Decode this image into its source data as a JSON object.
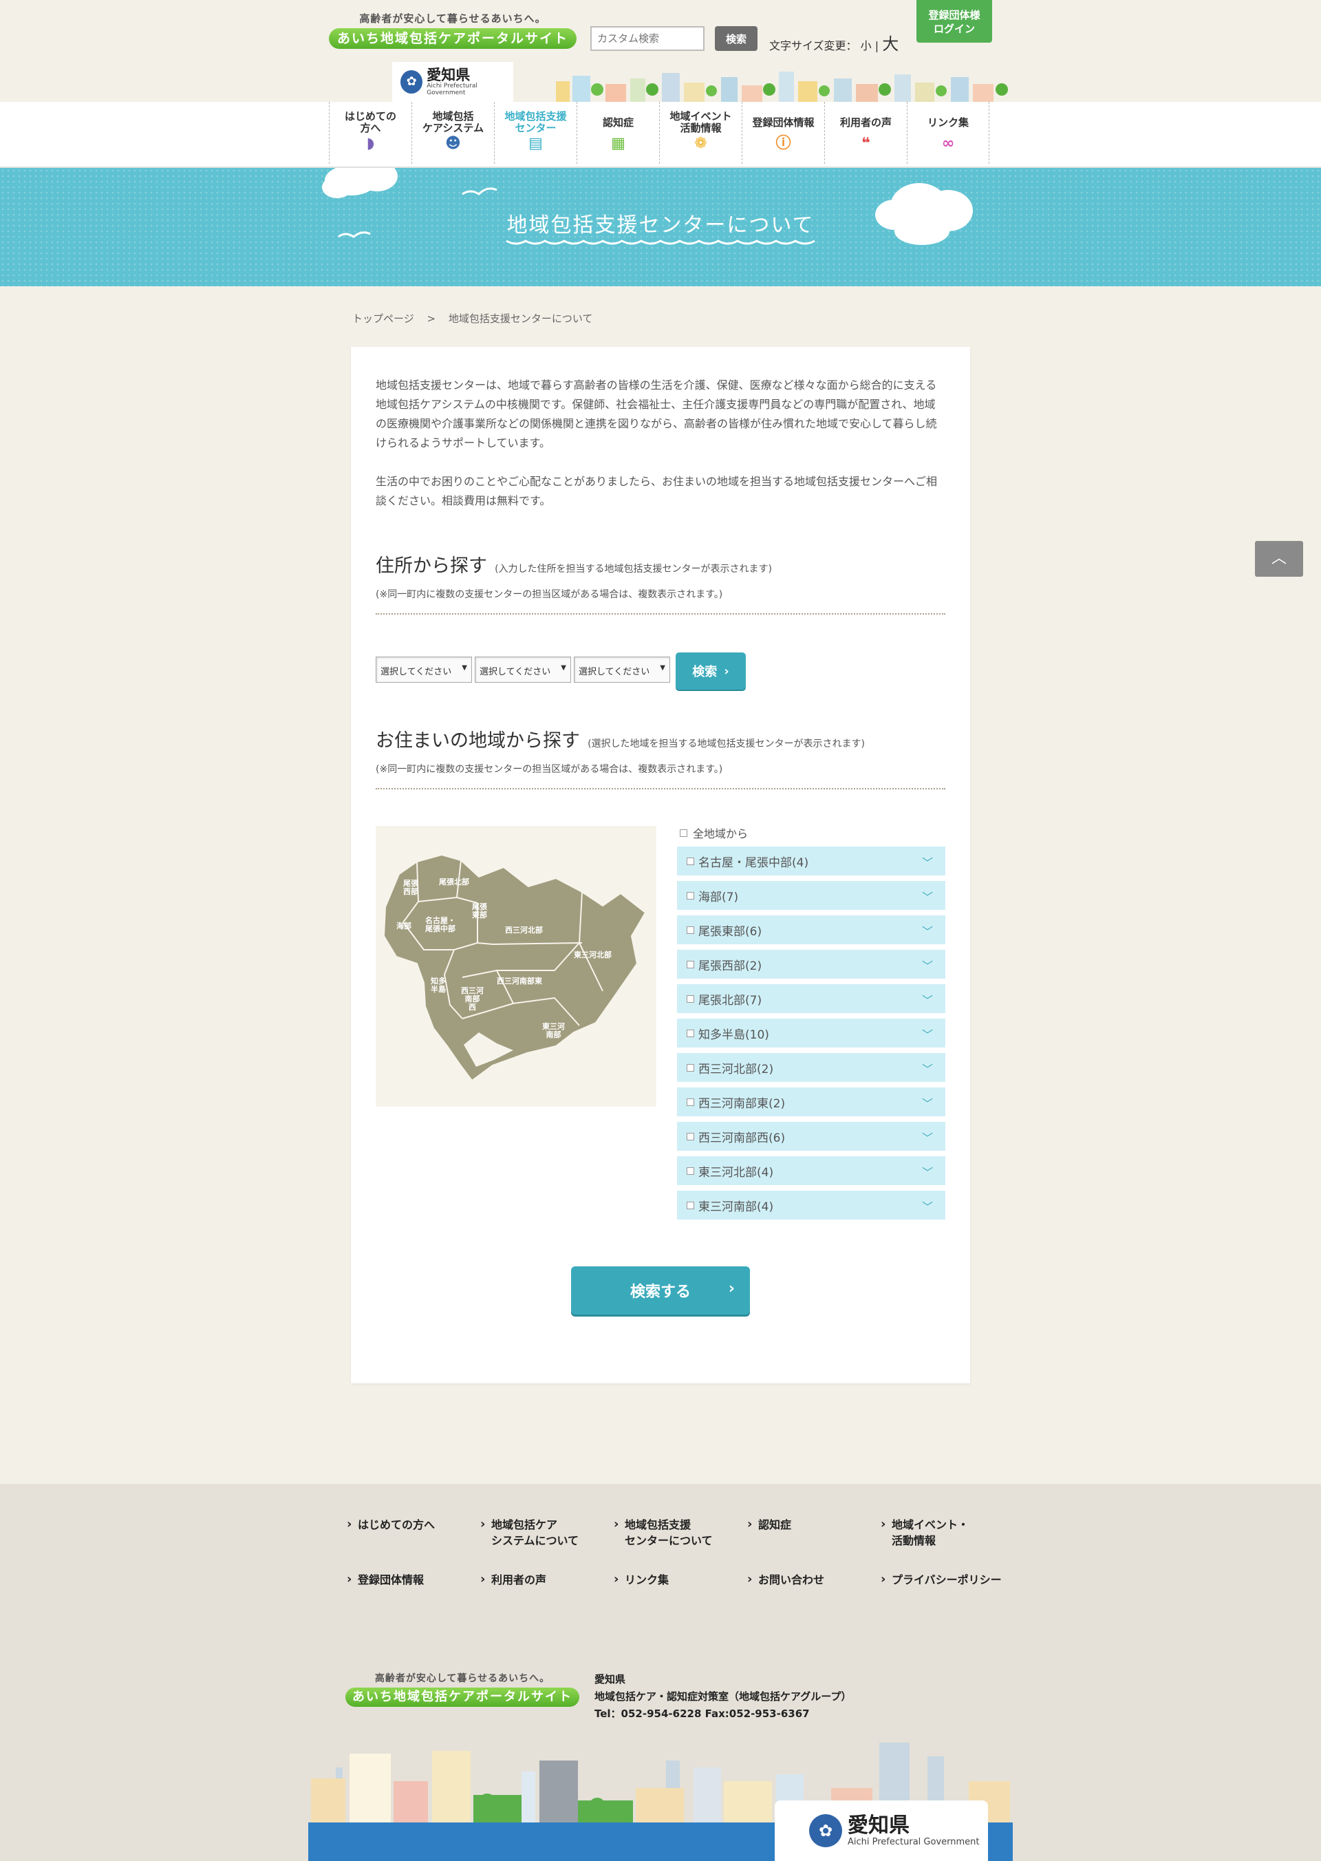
{
  "header": {
    "tagline": "高齢者が安心して暮らせるあいちへ。",
    "site_title": "あいち地域包括ケアポータルサイト",
    "search_placeholder": "カスタム検索",
    "search_button": "検索",
    "fontsize_label": "文字サイズ変更：",
    "fontsize_small": "小",
    "fontsize_sep": "|",
    "fontsize_large": "大",
    "login_line1": "登録団体様",
    "login_line2": "ログイン",
    "pref_name": "愛知県",
    "pref_name_en": "Aichi Prefectural Government"
  },
  "nav": {
    "items": [
      {
        "label": "はじめての\n方へ",
        "icon": "shoshinsha-mark-icon"
      },
      {
        "label": "地域包括\nケアシステム",
        "icon": "person-icon"
      },
      {
        "label": "地域包括支援\nセンター",
        "icon": "building-icon"
      },
      {
        "label": "認知症",
        "icon": "notebook-icon"
      },
      {
        "label": "地域イベント\n活動情報",
        "icon": "balloons-icon"
      },
      {
        "label": "登録団体情報",
        "icon": "info-icon"
      },
      {
        "label": "利用者の声",
        "icon": "speech-bubble-icon"
      },
      {
        "label": "リンク集",
        "icon": "link-icon"
      }
    ]
  },
  "banner": {
    "title": "地域包括支援センターについて"
  },
  "breadcrumb": {
    "home": "トップページ",
    "sep": ">",
    "current": "地域包括支援センターについて"
  },
  "intro": {
    "p1": "地域包括支援センターは、地域で暮らす高齢者の皆様の生活を介護、保健、医療など様々な面から総合的に支える地域包括ケアシステムの中核機関です。保健師、社会福祉士、主任介護支援専門員などの専門職が配置され、地域の医療機関や介護事業所などの関係機関と連携を図りながら、高齢者の皆様が住み慣れた地域で安心して暮らし続けられるようサポートしています。",
    "p2": "生活の中でお困りのことやご心配なことがありましたら、お住まいの地域を担当する地域包括支援センターへご相談ください。相談費用は無料です。"
  },
  "address_search": {
    "title": "住所から探す",
    "subtitle": "(入力した住所を担当する地域包括支援センターが表示されます)",
    "note": "(※同一町内に複数の支援センターの担当区域がある場合は、複数表示されます。)",
    "selects": [
      "選択してください",
      "選択してください",
      "選択してください"
    ],
    "button": "検索"
  },
  "area_search": {
    "title": "お住まいの地域から探す",
    "subtitle": "(選択した地域を担当する地域包括支援センターが表示されます)",
    "note": "(※同一町内に複数の支援センターの担当区域がある場合は、複数表示されます。)",
    "all_label": "全地域から",
    "regions": [
      "名古屋・尾張中部(4)",
      "海部(7)",
      "尾張東部(6)",
      "尾張西部(2)",
      "尾張北部(7)",
      "知多半島(10)",
      "西三河北部(2)",
      "西三河南部東(2)",
      "西三河南部西(6)",
      "東三河北部(4)",
      "東三河南部(4)"
    ],
    "map_labels": {
      "owari_seibu": "尾張\n西部",
      "owari_hokubu": "尾張北部",
      "ama": "海部",
      "nagoya": "名古屋・\n尾張中部",
      "owari_tobu": "尾張\n東部",
      "nishimikawa_hokubu": "西三河北部",
      "higashimikawa_hokubu": "東三河北部",
      "chita": "知多\n半島",
      "nishimikawa_nanbu_nishi": "西三河\n南部\n西",
      "nishimikawa_nanbu_higashi": "西三河南部東",
      "higashimikawa_nanbu": "東三河\n南部"
    },
    "submit": "検索する"
  },
  "to_top_icon": "chevron-up-icon",
  "footer": {
    "links_row1": [
      "はじめての方へ",
      "地域包括ケア\nシステムについて",
      "地域包括支援\nセンターについて",
      "認知症",
      "地域イベント・\n活動情報"
    ],
    "links_row2": [
      "登録団体情報",
      "利用者の声",
      "リンク集",
      "お問い合わせ",
      "プライバシーポリシー"
    ],
    "tagline": "高齢者が安心して暮らせるあいちへ。",
    "site_title": "あいち地域包括ケアポータルサイト",
    "org": "愛知県",
    "dept": "地域包括ケア・認知症対策室（地域包括ケアグループ）",
    "contact": "Tel：052-954-6228 Fax:052-953-6367",
    "pref_name": "愛知県",
    "pref_name_en": "Aichi Prefectural Government"
  },
  "colors": {
    "teal": "#3aaabb",
    "banner": "#5fc2d2",
    "region_bg": "#cfeff6",
    "login_green": "#52b052",
    "map_fill": "#a09c7e"
  }
}
